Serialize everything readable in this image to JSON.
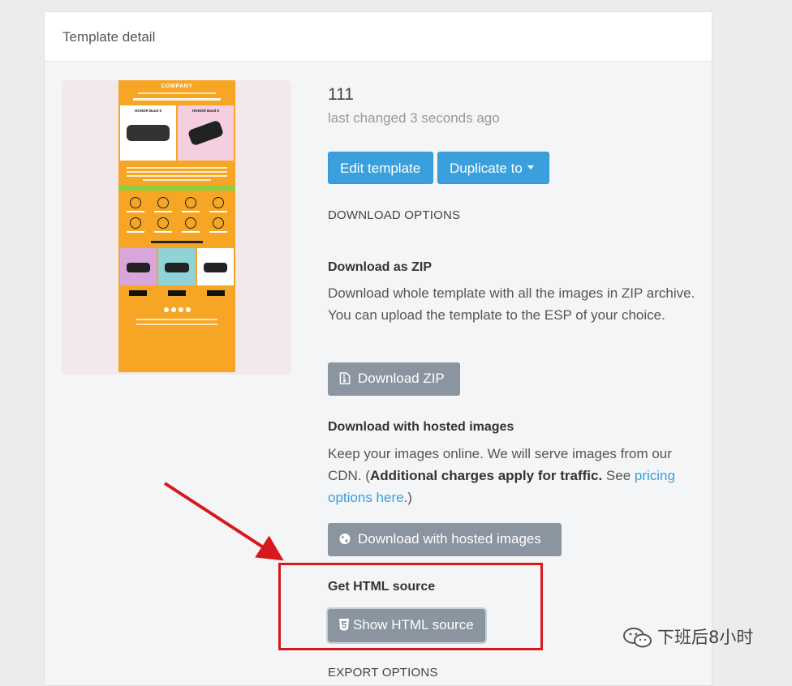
{
  "panel": {
    "title": "Template detail"
  },
  "preview": {
    "brand": "COMPANY",
    "card1_label": "HONOR Band 5",
    "card2_label": "HONOR Band 5"
  },
  "template": {
    "name": "111",
    "changed": "last changed 3 seconds ago",
    "edit_label": "Edit template",
    "duplicate_label": "Duplicate to"
  },
  "download": {
    "section_title": "DOWNLOAD OPTIONS",
    "zip": {
      "heading": "Download as ZIP",
      "text": "Download whole template with all the images in ZIP archive. You can upload the template to the ESP of your choice.",
      "button": "Download ZIP",
      "icon": "file-zip-icon"
    },
    "hosted": {
      "heading": "Download with hosted images",
      "text_a": "Keep your images online. We will serve images from our CDN. (",
      "text_bold": "Additional charges apply for traffic.",
      "text_b": " See ",
      "link": "pricing options here",
      "text_c": ".)",
      "button": "Download with hosted images",
      "icon": "globe-icon"
    },
    "html": {
      "heading": "Get HTML source",
      "button": "Show HTML source",
      "icon": "html5-icon"
    }
  },
  "export": {
    "section_title": "EXPORT OPTIONS"
  },
  "annotation": {
    "color": "#d8181c"
  },
  "watermark": {
    "text": "下班后8小时",
    "icon": "wechat-icon"
  },
  "colors": {
    "primary": "#3aa0dd",
    "secondary": "#8b959f",
    "preview_bg": "#f6a524"
  }
}
